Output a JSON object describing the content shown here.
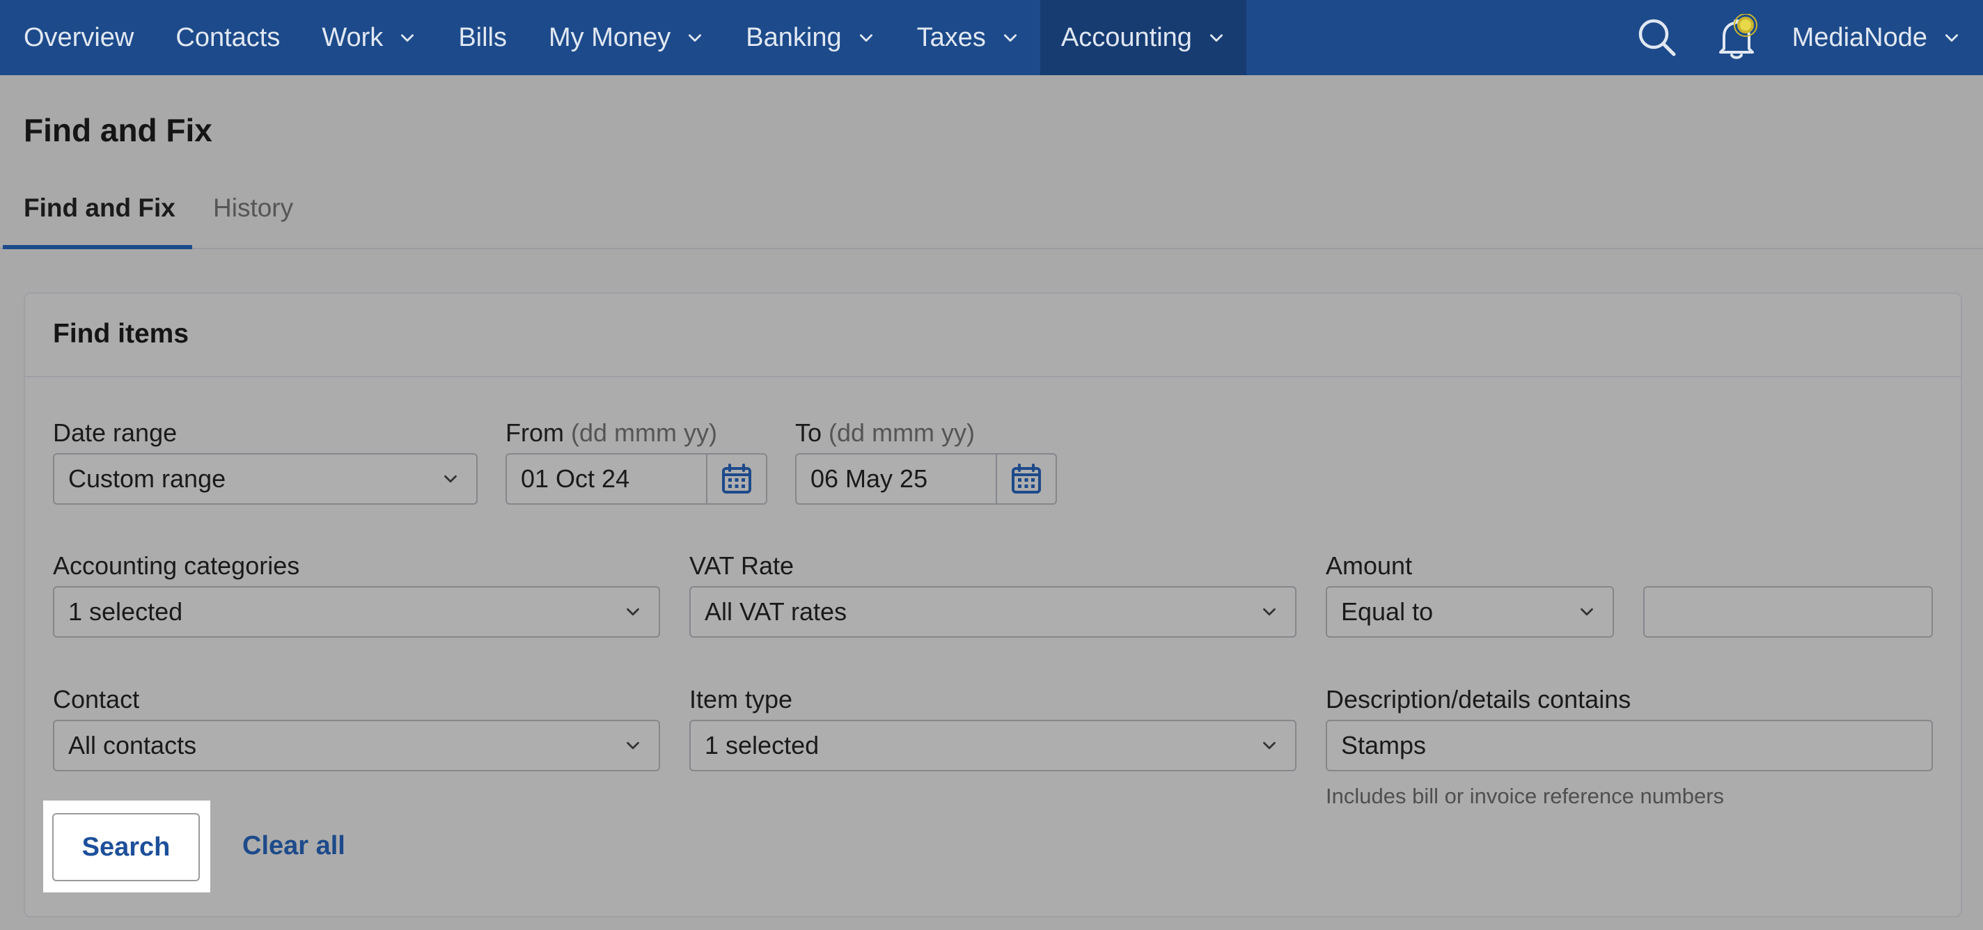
{
  "nav": {
    "items": [
      {
        "label": "Overview",
        "dropdown": false
      },
      {
        "label": "Contacts",
        "dropdown": false
      },
      {
        "label": "Work",
        "dropdown": true
      },
      {
        "label": "Bills",
        "dropdown": false
      },
      {
        "label": "My Money",
        "dropdown": true
      },
      {
        "label": "Banking",
        "dropdown": true
      },
      {
        "label": "Taxes",
        "dropdown": true
      },
      {
        "label": "Accounting",
        "dropdown": true,
        "active": true
      }
    ],
    "account_name": "MediaNode",
    "icons": {
      "search": "search-icon",
      "notifications": "bell-icon"
    }
  },
  "page": {
    "title": "Find and Fix",
    "tabs": [
      {
        "label": "Find and Fix",
        "active": true
      },
      {
        "label": "History",
        "active": false
      }
    ]
  },
  "panel": {
    "title": "Find items",
    "date_range": {
      "label": "Date range",
      "value": "Custom range"
    },
    "from": {
      "label": "From",
      "hint": "(dd mmm yy)",
      "value": "01 Oct 24"
    },
    "to": {
      "label": "To",
      "hint": "(dd mmm yy)",
      "value": "06 May 25"
    },
    "accounting_categories": {
      "label": "Accounting categories",
      "value": "1 selected"
    },
    "vat_rate": {
      "label": "VAT Rate",
      "value": "All VAT rates"
    },
    "amount": {
      "label": "Amount",
      "operator": "Equal to",
      "value": ""
    },
    "contact": {
      "label": "Contact",
      "value": "All contacts"
    },
    "item_type": {
      "label": "Item type",
      "value": "1 selected"
    },
    "description": {
      "label": "Description/details contains",
      "value": "Stamps",
      "helper": "Includes bill or invoice reference numbers"
    },
    "search_label": "Search",
    "clear_label": "Clear all"
  },
  "colors": {
    "nav_bg": "#1d4a8a",
    "nav_active_bg": "#173c72",
    "link": "#1d4a8a",
    "notification_dot": "#e8d84a"
  }
}
